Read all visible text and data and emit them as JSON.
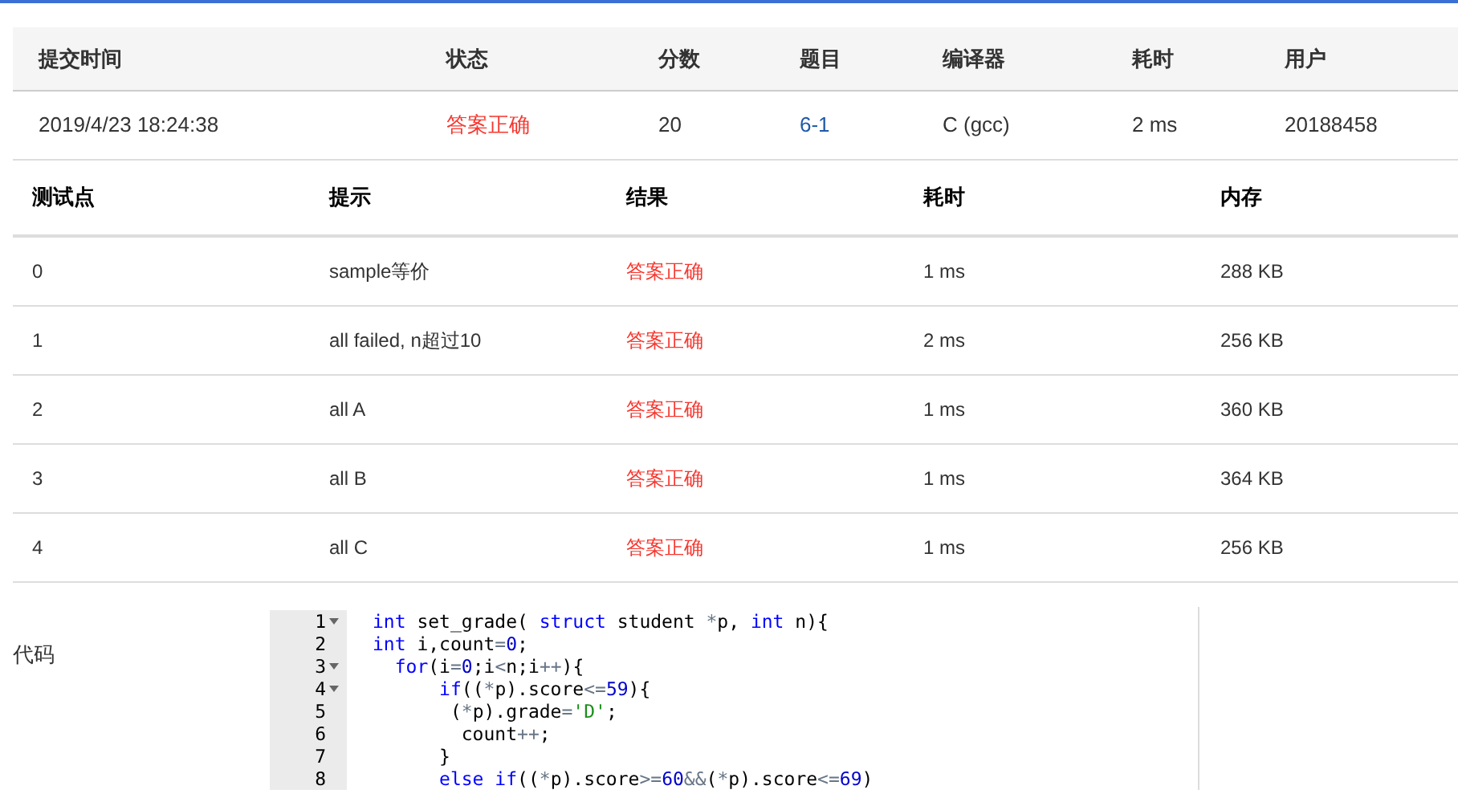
{
  "submission": {
    "columns": [
      "提交时间",
      "状态",
      "分数",
      "题目",
      "编译器",
      "耗时",
      "用户"
    ],
    "row": {
      "time": "2019/4/23 18:24:38",
      "status": "答案正确",
      "score": "20",
      "problem": "6-1",
      "compiler": "C (gcc)",
      "elapsed": "2 ms",
      "user": "20188458"
    }
  },
  "tests": {
    "columns": [
      "测试点",
      "提示",
      "结果",
      "耗时",
      "内存"
    ],
    "rows": [
      {
        "id": "0",
        "hint": "sample等价",
        "result": "答案正确",
        "time": "1 ms",
        "memory": "288 KB"
      },
      {
        "id": "1",
        "hint": "all failed, n超过10",
        "result": "答案正确",
        "time": "2 ms",
        "memory": "256 KB"
      },
      {
        "id": "2",
        "hint": "all A",
        "result": "答案正确",
        "time": "1 ms",
        "memory": "360 KB"
      },
      {
        "id": "3",
        "hint": "all B",
        "result": "答案正确",
        "time": "1 ms",
        "memory": "364 KB"
      },
      {
        "id": "4",
        "hint": "all C",
        "result": "答案正确",
        "time": "1 ms",
        "memory": "256 KB"
      }
    ]
  },
  "code": {
    "label": "代码",
    "lines": [
      {
        "number": "1",
        "foldable": true,
        "tokens": [
          {
            "kind": "keyword",
            "text": "int"
          },
          {
            "kind": "plain",
            "text": " set_grade( "
          },
          {
            "kind": "keyword",
            "text": "struct"
          },
          {
            "kind": "plain",
            "text": " student "
          },
          {
            "kind": "operator",
            "text": "*"
          },
          {
            "kind": "plain",
            "text": "p, "
          },
          {
            "kind": "keyword",
            "text": "int"
          },
          {
            "kind": "plain",
            "text": " n){"
          }
        ]
      },
      {
        "number": "2",
        "foldable": false,
        "tokens": [
          {
            "kind": "keyword",
            "text": "int"
          },
          {
            "kind": "plain",
            "text": " i,count"
          },
          {
            "kind": "operator",
            "text": "="
          },
          {
            "kind": "number",
            "text": "0"
          },
          {
            "kind": "plain",
            "text": ";"
          }
        ]
      },
      {
        "number": "3",
        "foldable": true,
        "tokens": [
          {
            "kind": "keyword",
            "text": "  for"
          },
          {
            "kind": "plain",
            "text": "(i"
          },
          {
            "kind": "operator",
            "text": "="
          },
          {
            "kind": "number",
            "text": "0"
          },
          {
            "kind": "plain",
            "text": ";i"
          },
          {
            "kind": "operator",
            "text": "<"
          },
          {
            "kind": "plain",
            "text": "n;i"
          },
          {
            "kind": "operator",
            "text": "++"
          },
          {
            "kind": "plain",
            "text": "){"
          }
        ]
      },
      {
        "number": "4",
        "foldable": true,
        "tokens": [
          {
            "kind": "keyword",
            "text": "      if"
          },
          {
            "kind": "plain",
            "text": "(("
          },
          {
            "kind": "operator",
            "text": "*"
          },
          {
            "kind": "plain",
            "text": "p).score"
          },
          {
            "kind": "operator",
            "text": "<="
          },
          {
            "kind": "number",
            "text": "59"
          },
          {
            "kind": "plain",
            "text": "){"
          }
        ]
      },
      {
        "number": "5",
        "foldable": false,
        "tokens": [
          {
            "kind": "plain",
            "text": "       ("
          },
          {
            "kind": "operator",
            "text": "*"
          },
          {
            "kind": "plain",
            "text": "p).grade"
          },
          {
            "kind": "operator",
            "text": "="
          },
          {
            "kind": "string",
            "text": "'D'"
          },
          {
            "kind": "plain",
            "text": ";"
          }
        ]
      },
      {
        "number": "6",
        "foldable": false,
        "tokens": [
          {
            "kind": "plain",
            "text": "        count"
          },
          {
            "kind": "operator",
            "text": "++"
          },
          {
            "kind": "plain",
            "text": ";"
          }
        ]
      },
      {
        "number": "7",
        "foldable": false,
        "tokens": [
          {
            "kind": "plain",
            "text": "      }"
          }
        ]
      },
      {
        "number": "8",
        "foldable": false,
        "tokens": [
          {
            "kind": "keyword",
            "text": "      else if"
          },
          {
            "kind": "plain",
            "text": "(("
          },
          {
            "kind": "operator",
            "text": "*"
          },
          {
            "kind": "plain",
            "text": "p).score"
          },
          {
            "kind": "operator",
            "text": ">="
          },
          {
            "kind": "number",
            "text": "60"
          },
          {
            "kind": "operator",
            "text": "&&"
          },
          {
            "kind": "plain",
            "text": "("
          },
          {
            "kind": "operator",
            "text": "*"
          },
          {
            "kind": "plain",
            "text": "p).score"
          },
          {
            "kind": "operator",
            "text": "<="
          },
          {
            "kind": "number",
            "text": "69"
          },
          {
            "kind": "plain",
            "text": ")"
          }
        ]
      }
    ]
  }
}
